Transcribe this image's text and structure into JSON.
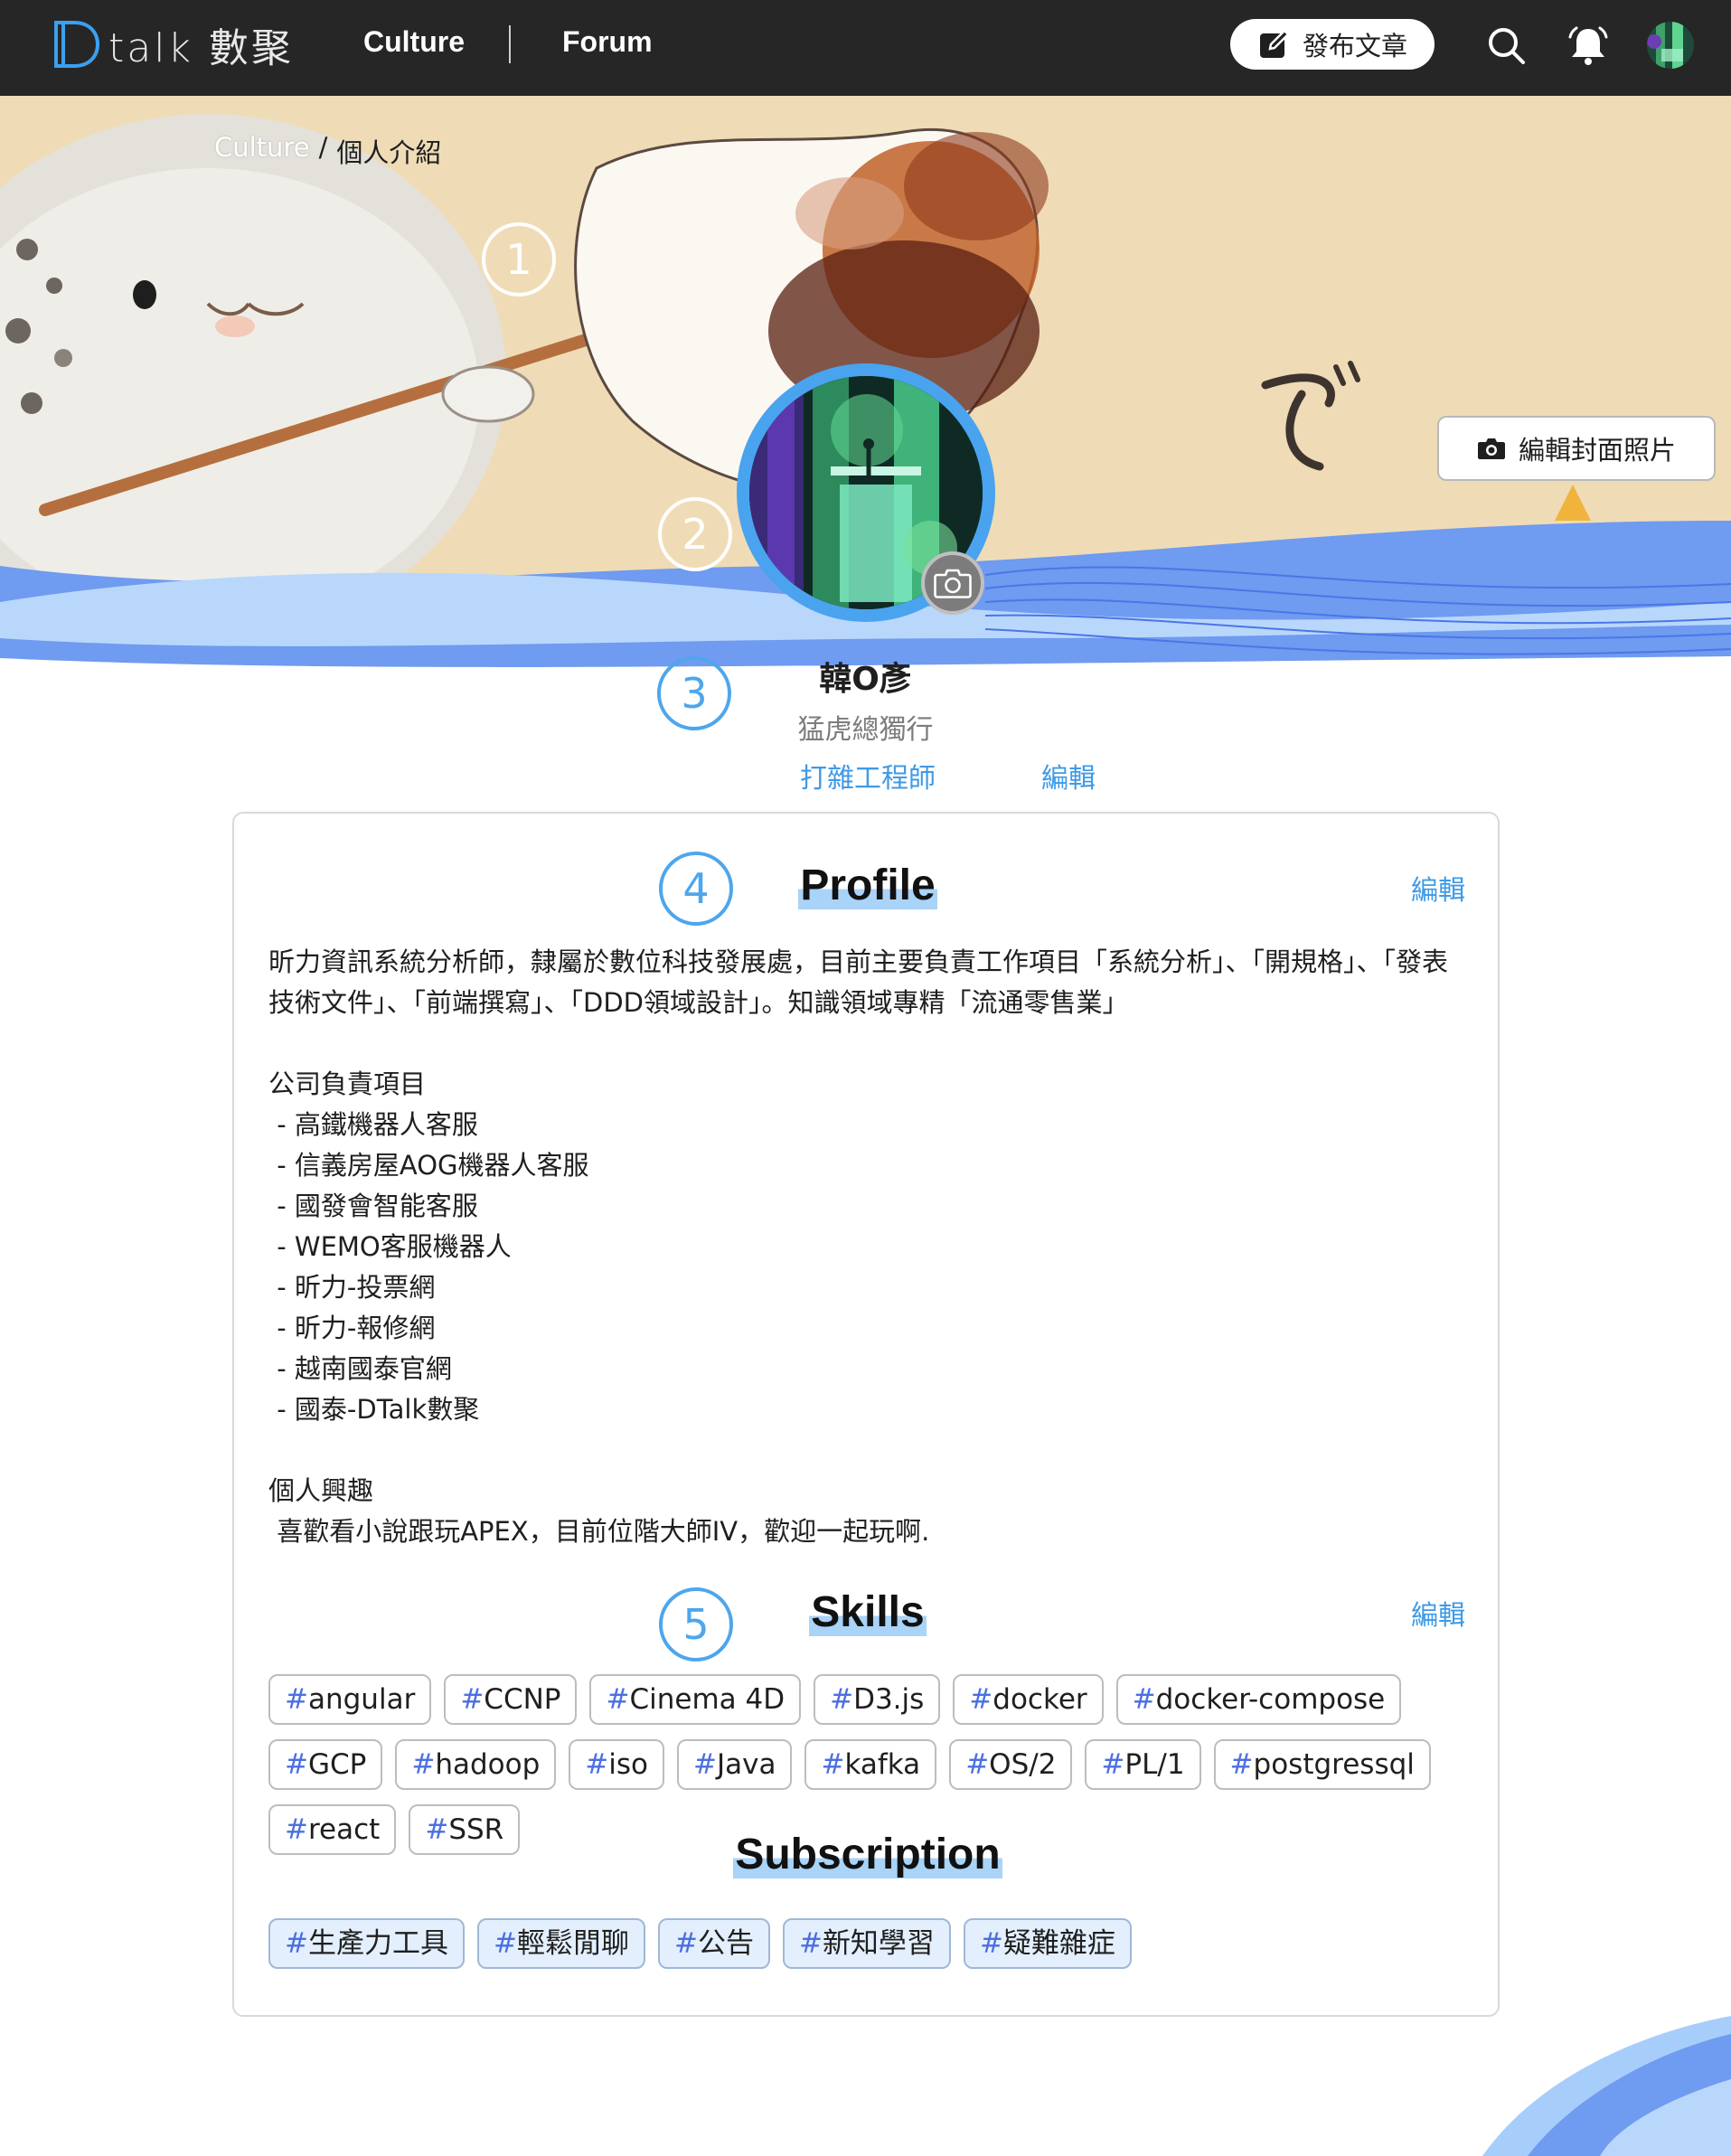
{
  "nav": {
    "logo_text": "talk 數聚",
    "links": [
      "Culture",
      "Forum"
    ],
    "publish_label": "發布文章"
  },
  "breadcrumb": {
    "parent": "Culture",
    "separator": "/",
    "current": "個人介紹"
  },
  "cover": {
    "edit_cover_label": "編輯封面照片"
  },
  "steps": [
    "1",
    "2",
    "3",
    "4",
    "5"
  ],
  "user": {
    "name": "韓O彥",
    "title": "猛虎總獨行",
    "role": "打雜工程師",
    "edit_label": "編輯"
  },
  "profile": {
    "heading": "Profile",
    "edit_label": "編輯",
    "body": "昕力資訊系統分析師，隸屬於數位科技發展處，目前主要負責工作項目「系統分析」、「開規格」、「發表技術文件」、「前端撰寫」、「DDD領域設計」。知識領域專精「流通零售業」\n\n公司負責項目\n - 高鐵機器人客服\n - 信義房屋AOG機器人客服\n - 國發會智能客服\n - WEMO客服機器人\n - 昕力-投票網\n - 昕力-報修網\n - 越南國泰官網\n - 國泰-DTalk數聚\n\n個人興趣\n 喜歡看小說跟玩APEX，目前位階大師IV，歡迎一起玩啊."
  },
  "skills": {
    "heading": "Skills",
    "edit_label": "編輯",
    "tags": [
      "angular",
      "CCNP",
      "Cinema 4D",
      "D3.js",
      "docker",
      "docker-compose",
      "GCP",
      "hadoop",
      "iso",
      "Java",
      "kafka",
      "OS/2",
      "PL/1",
      "postgressql",
      "react",
      "SSR"
    ]
  },
  "subscription": {
    "heading": "Subscription",
    "tags": [
      "生產力工具",
      "輕鬆閒聊",
      "公告",
      "新知學習",
      "疑難雜症"
    ]
  },
  "colors": {
    "nav_bg": "#262626",
    "accent": "#3f9ae6",
    "hash": "#4b6fe0",
    "wave": "#6f9bf0",
    "sub_tag_bg": "#e3effd"
  },
  "icons": [
    "logo-d-icon",
    "edit-icon",
    "search-icon",
    "bell-icon",
    "camera-icon"
  ]
}
